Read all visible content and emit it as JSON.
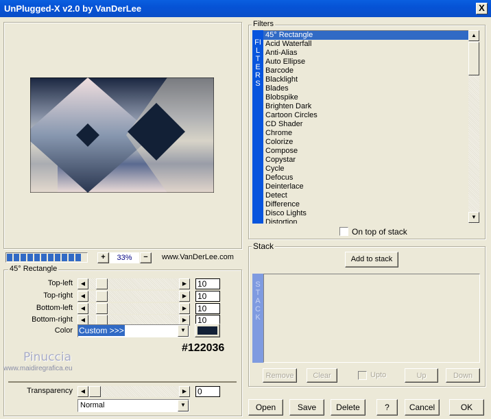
{
  "window": {
    "title": "UnPlugged-X v2.0 by VanDerLee",
    "close": "X"
  },
  "preview": {
    "zoom": "33%",
    "zoom_in": "+",
    "zoom_out": "−",
    "url": "www.VanDerLee.com",
    "progress_segments": 11
  },
  "settings": {
    "group_title": "45° Rectangle",
    "sliders": [
      {
        "label": "Top-left",
        "value": "10"
      },
      {
        "label": "Top-right",
        "value": "10"
      },
      {
        "label": "Bottom-left",
        "value": "10"
      },
      {
        "label": "Bottom-right",
        "value": "10"
      }
    ],
    "color_label": "Color",
    "color_option": "Custom >>>",
    "color_value": "#122036",
    "color_hex_text": "#122036",
    "transparency_label": "Transparency",
    "transparency_value": "0",
    "blend_mode": "Normal"
  },
  "watermark": {
    "name": "Pinuccia",
    "site": "www.maidiregrafica.eu"
  },
  "filters": {
    "group_title": "Filters",
    "side_label": "FILTERS",
    "items": [
      "45° Rectangle",
      "Acid Waterfall",
      "Anti-Alias",
      "Auto Ellipse",
      "Barcode",
      "Blacklight",
      "Blades",
      "Blobspike",
      "Brighten Dark",
      "Cartoon Circles",
      "CD Shader",
      "Chrome",
      "Colorize",
      "Compose",
      "Copystar",
      "Cycle",
      "Defocus",
      "Deinterlace",
      "Detect",
      "Difference",
      "Disco Lights",
      "Distortion"
    ],
    "on_top_label": "On top of stack"
  },
  "stack": {
    "group_title": "Stack",
    "side_label": "STACK",
    "add": "Add to stack",
    "remove": "Remove",
    "clear": "Clear",
    "upto": "Upto",
    "up": "Up",
    "down": "Down"
  },
  "buttons": {
    "open": "Open",
    "save": "Save",
    "delete": "Delete",
    "help": "?",
    "cancel": "Cancel",
    "ok": "OK"
  }
}
